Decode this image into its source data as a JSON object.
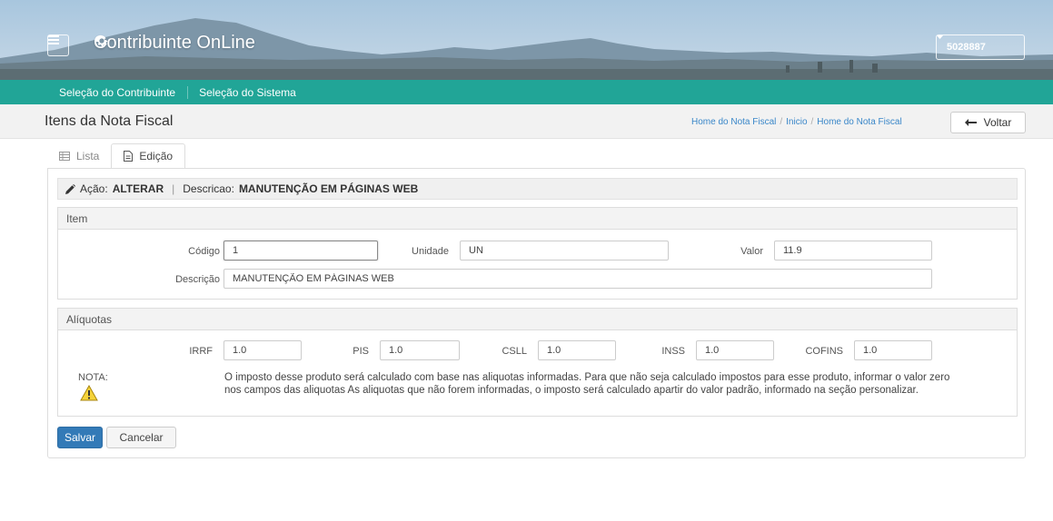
{
  "header": {
    "menu_icon": "hamburger-menu-icon",
    "gear_icon": "gear-icon",
    "app_title": "Contribuinte OnLine",
    "user_label": "5028887",
    "user_caret": "caret-down-icon"
  },
  "nav": {
    "items": [
      {
        "label": "Seleção do Contribuinte"
      },
      {
        "label": "Seleção do Sistema"
      }
    ],
    "color": "#21a597"
  },
  "page": {
    "title": "Itens da Nota Fiscal",
    "breadcrumb": [
      "Home do Nota Fiscal",
      "Inicio",
      "Home do Nota Fiscal"
    ],
    "breadcrumb_sep": "/",
    "back_label": "Voltar",
    "back_icon": "arrow-left-icon"
  },
  "tabs": [
    {
      "label": "Lista",
      "icon": "table-icon",
      "active": false
    },
    {
      "label": "Edição",
      "icon": "document-icon",
      "active": true
    }
  ],
  "action_bar": {
    "icon": "pencil-icon",
    "action_prefix": "Ação:",
    "action_value": "ALTERAR",
    "separator": "|",
    "desc_prefix": "Descricao:",
    "desc_value": "MANUTENÇÃO EM PÁGINAS WEB"
  },
  "item_section": {
    "title": "Item",
    "codigo": {
      "label": "Código",
      "value": "1"
    },
    "unidade": {
      "label": "Unidade",
      "value": "UN"
    },
    "valor": {
      "label": "Valor",
      "value": "11.9"
    },
    "descricao": {
      "label": "Descrição",
      "value": "MANUTENÇÃO EM PÁGINAS WEB"
    }
  },
  "aliquotas_section": {
    "title": "Alíquotas",
    "irrf": {
      "label": "IRRF",
      "value": "1.0"
    },
    "pis": {
      "label": "PIS",
      "value": "1.0"
    },
    "csll": {
      "label": "CSLL",
      "value": "1.0"
    },
    "inss": {
      "label": "INSS",
      "value": "1.0"
    },
    "cofins": {
      "label": "COFINS",
      "value": "1.0"
    },
    "nota_label": "NOTA:",
    "nota_icon": "warning-icon",
    "nota_text": "O imposto desse produto será calculado com base nas aliquotas informadas. Para que não seja calculado impostos para esse produto, informar o valor zero nos campos das aliquotas As aliquotas que não forem informadas, o imposto será calculado apartir do valor padrão, informado na seção personalizar."
  },
  "buttons": {
    "save": "Salvar",
    "cancel": "Cancelar",
    "save_color": "#337ab7"
  }
}
